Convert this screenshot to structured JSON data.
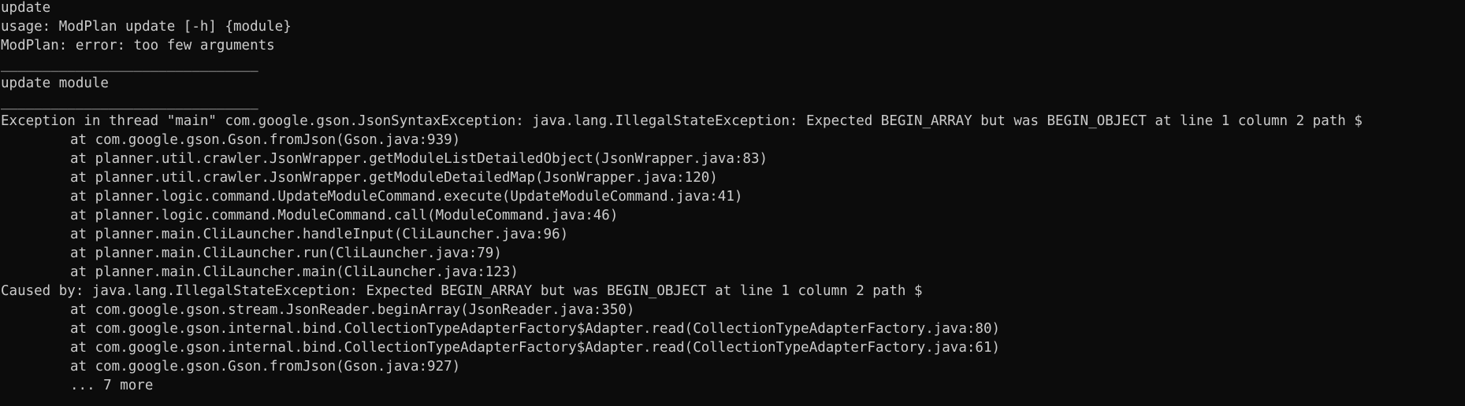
{
  "console": {
    "lines": [
      {
        "text": "update",
        "indent": false
      },
      {
        "text": "usage: ModPlan update [-h] {module}",
        "indent": false
      },
      {
        "text": "ModPlan: error: too few arguments",
        "indent": false
      },
      {
        "text": "_______________________________",
        "indent": false
      },
      {
        "text": "update module",
        "indent": false
      },
      {
        "text": "_______________________________",
        "indent": false
      },
      {
        "text": "Exception in thread \"main\" com.google.gson.JsonSyntaxException: java.lang.IllegalStateException: Expected BEGIN_ARRAY but was BEGIN_OBJECT at line 1 column 2 path $",
        "indent": false
      },
      {
        "text": "at com.google.gson.Gson.fromJson(Gson.java:939)",
        "indent": true
      },
      {
        "text": "at planner.util.crawler.JsonWrapper.getModuleListDetailedObject(JsonWrapper.java:83)",
        "indent": true
      },
      {
        "text": "at planner.util.crawler.JsonWrapper.getModuleDetailedMap(JsonWrapper.java:120)",
        "indent": true
      },
      {
        "text": "at planner.logic.command.UpdateModuleCommand.execute(UpdateModuleCommand.java:41)",
        "indent": true
      },
      {
        "text": "at planner.logic.command.ModuleCommand.call(ModuleCommand.java:46)",
        "indent": true
      },
      {
        "text": "at planner.main.CliLauncher.handleInput(CliLauncher.java:96)",
        "indent": true
      },
      {
        "text": "at planner.main.CliLauncher.run(CliLauncher.java:79)",
        "indent": true
      },
      {
        "text": "at planner.main.CliLauncher.main(CliLauncher.java:123)",
        "indent": true
      },
      {
        "text": "Caused by: java.lang.IllegalStateException: Expected BEGIN_ARRAY but was BEGIN_OBJECT at line 1 column 2 path $",
        "indent": false
      },
      {
        "text": "at com.google.gson.stream.JsonReader.beginArray(JsonReader.java:350)",
        "indent": true
      },
      {
        "text": "at com.google.gson.internal.bind.CollectionTypeAdapterFactory$Adapter.read(CollectionTypeAdapterFactory.java:80)",
        "indent": true
      },
      {
        "text": "at com.google.gson.internal.bind.CollectionTypeAdapterFactory$Adapter.read(CollectionTypeAdapterFactory.java:61)",
        "indent": true
      },
      {
        "text": "at com.google.gson.Gson.fromJson(Gson.java:927)",
        "indent": true
      },
      {
        "text": "... 7 more",
        "indent": true
      }
    ]
  },
  "colors": {
    "background": "#0c0c0c",
    "foreground": "#cccccc"
  }
}
